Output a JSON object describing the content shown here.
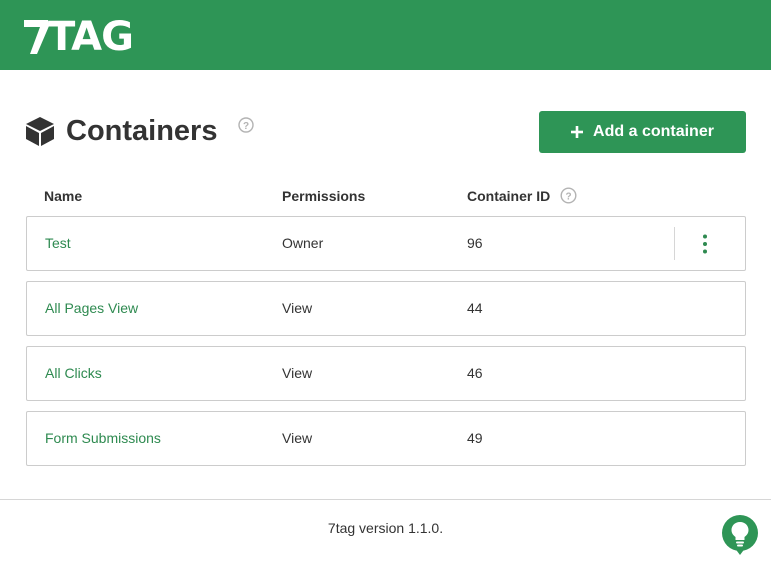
{
  "app": {
    "logo_text": "TAG",
    "brand_color": "#2e9556",
    "link_color": "#2e8a50"
  },
  "header": {
    "title": "Containers",
    "title_icon": "cube-icon",
    "help_icon": "question-circle-icon",
    "add_button_label": "Add a container",
    "add_button_icon": "plus-icon"
  },
  "table": {
    "columns": {
      "name": "Name",
      "permissions": "Permissions",
      "container_id": "Container ID"
    },
    "rows": [
      {
        "name": "Test",
        "permission": "Owner",
        "id": "96",
        "has_menu": true
      },
      {
        "name": "All Pages View",
        "permission": "View",
        "id": "44",
        "has_menu": false
      },
      {
        "name": "All Clicks",
        "permission": "View",
        "id": "46",
        "has_menu": false
      },
      {
        "name": "Form Submissions",
        "permission": "View",
        "id": "49",
        "has_menu": false
      }
    ]
  },
  "footer": {
    "version_text": "7tag version 1.1.0.",
    "help_bubble_icon": "lightbulb-help-icon"
  }
}
